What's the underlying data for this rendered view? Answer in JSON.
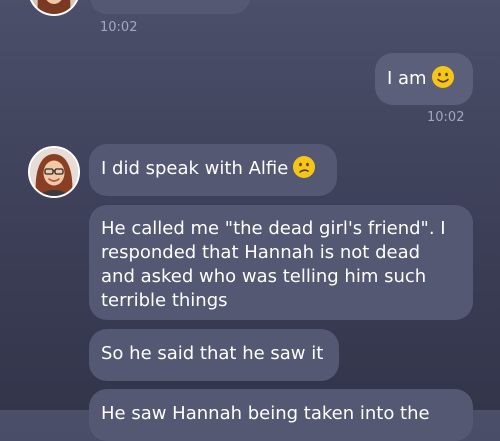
{
  "messages": [
    {
      "id": "m0",
      "sender": "contact",
      "text": "",
      "time": "10:02"
    },
    {
      "id": "m1",
      "sender": "me",
      "text": "I am",
      "emoji": "slightly-smiling-face",
      "time": "10:02"
    },
    {
      "id": "m2",
      "sender": "contact",
      "text": "I did speak with Alfie",
      "emoji": "confused-face"
    },
    {
      "id": "m3",
      "sender": "contact",
      "lines": [
        "He called me \"the dead girl's friend\". I",
        "responded that Hannah is not dead",
        "and asked who was telling him such",
        "terrible things"
      ]
    },
    {
      "id": "m4",
      "sender": "contact",
      "text": "So he said that he saw it"
    },
    {
      "id": "m5",
      "sender": "contact",
      "text": "He saw Hannah being taken into the"
    }
  ],
  "colors": {
    "bubble": "#545872",
    "timestamp": "#a3a6bb",
    "emoji": "#f5c518"
  }
}
